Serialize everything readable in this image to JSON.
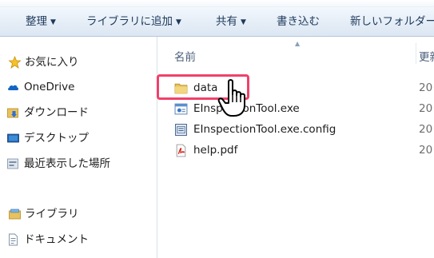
{
  "toolbar": {
    "items": [
      {
        "label": "整理",
        "dropdown": true
      },
      {
        "label": "ライブラリに追加",
        "dropdown": true
      },
      {
        "label": "共有",
        "dropdown": true
      },
      {
        "label": "書き込む",
        "dropdown": false
      },
      {
        "label": "新しいフォルダー",
        "dropdown": false
      }
    ]
  },
  "nav": {
    "favorites": {
      "label": "お気に入り",
      "icon": "star-icon"
    },
    "favorite_items": [
      {
        "label": "OneDrive",
        "icon": "onedrive-icon"
      },
      {
        "label": "ダウンロード",
        "icon": "download-folder-icon"
      },
      {
        "label": "デスクトップ",
        "icon": "desktop-icon"
      },
      {
        "label": "最近表示した場所",
        "icon": "recent-places-icon"
      }
    ],
    "libraries": {
      "label": "ライブラリ",
      "icon": "library-icon"
    },
    "library_items": [
      {
        "label": "ドキュメント",
        "icon": "document-icon"
      }
    ]
  },
  "content": {
    "columns": {
      "name": "名前",
      "date": "更新"
    },
    "files": [
      {
        "name": "data",
        "icon": "folder-icon",
        "date": "20"
      },
      {
        "name": "EInspectionTool.exe",
        "icon": "exe-icon",
        "date": "20"
      },
      {
        "name": "EInspectionTool.exe.config",
        "icon": "config-file-icon",
        "date": "20"
      },
      {
        "name": "help.pdf",
        "icon": "pdf-icon",
        "date": "20"
      }
    ]
  },
  "colors": {
    "highlight": "#f0416a",
    "toolbar_text": "#1e395b",
    "folder": "#e8c25a"
  }
}
